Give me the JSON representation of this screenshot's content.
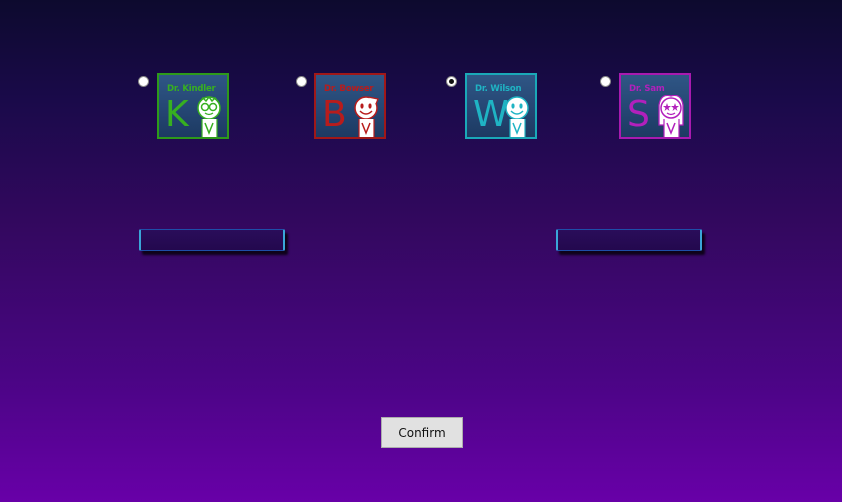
{
  "doctors": [
    {
      "name": "Dr. Kindler",
      "letter": "K",
      "selected": false,
      "color": "#37b020",
      "icon": "doctor-avatar-glasses"
    },
    {
      "name": "Dr. Bowser",
      "letter": "B",
      "selected": false,
      "color": "#b81c1c",
      "icon": "doctor-avatar-smile"
    },
    {
      "name": "Dr. Wilson",
      "letter": "W",
      "selected": true,
      "color": "#1fb4c4",
      "icon": "doctor-avatar-smile"
    },
    {
      "name": "Dr. Sam",
      "letter": "S",
      "selected": false,
      "color": "#b220bc",
      "icon": "doctor-avatar-star-eyes"
    }
  ],
  "confirm_label": "Confirm",
  "colors": {
    "background_top": "#0d0a2e",
    "background_bottom": "#6800a8",
    "bar_edge": "#3aa6d8"
  }
}
